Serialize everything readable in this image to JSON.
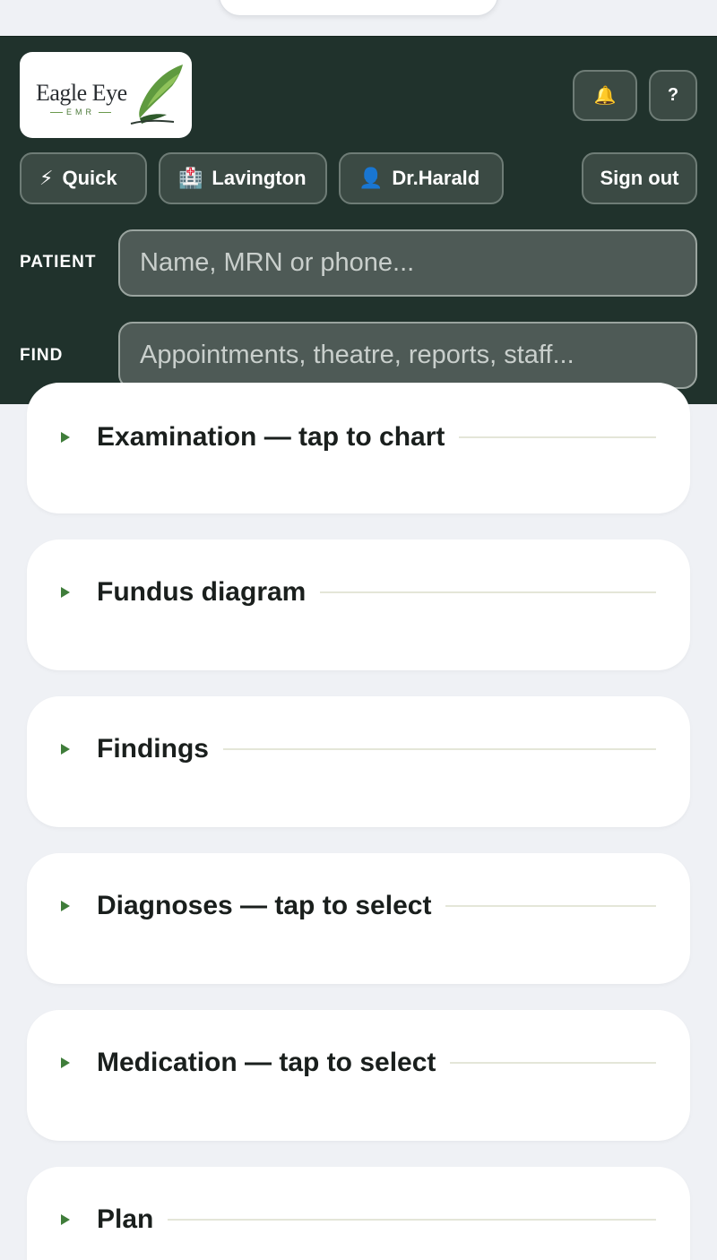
{
  "header": {
    "logo": {
      "name": "Eagle Eye",
      "sub": "EMR"
    },
    "bell_icon": "bell-icon",
    "help_label": "?",
    "chips": [
      {
        "icon": "⚡",
        "label": "Quick"
      },
      {
        "icon": "🏥",
        "label": "Lavington"
      },
      {
        "icon": "👤",
        "label": "Dr.Harald"
      }
    ],
    "signout_label": "Sign out"
  },
  "search": {
    "patient_label": "PATIENT",
    "patient_placeholder": "Name, MRN or phone...",
    "find_label": "FIND",
    "find_placeholder": "Appointments, theatre, reports, staff..."
  },
  "sections": [
    {
      "title": "Examination — tap to chart"
    },
    {
      "title": "Fundus diagram"
    },
    {
      "title": "Findings"
    },
    {
      "title": "Diagnoses — tap to select"
    },
    {
      "title": "Medication — tap to select"
    },
    {
      "title": "Plan"
    }
  ],
  "colors": {
    "header_bg": "#20322c",
    "accent": "#3f7d3a",
    "page_bg": "#eff1f5"
  }
}
